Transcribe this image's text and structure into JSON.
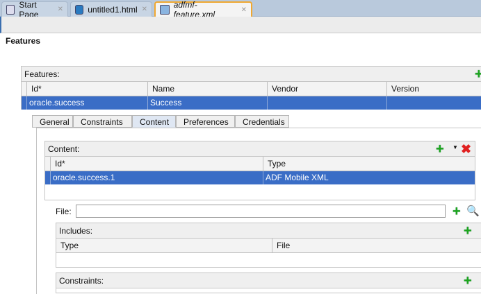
{
  "tabs": [
    {
      "label": "Start Page",
      "icon": "page-icon"
    },
    {
      "label": "untitled1.html",
      "icon": "globe-icon"
    },
    {
      "label": "adfmf-feature.xml",
      "icon": "feature-xml-icon",
      "active": true
    }
  ],
  "page_title": "Features",
  "features": {
    "label": "Features:",
    "columns": [
      "Id*",
      "Name",
      "Vendor",
      "Version"
    ],
    "rows": [
      [
        "oracle.success",
        "Success",
        "",
        ""
      ]
    ]
  },
  "subtabs": [
    "General",
    "Constraints",
    "Content",
    "Preferences",
    "Credentials"
  ],
  "active_subtab": "Content",
  "content": {
    "label": "Content:",
    "columns": [
      "Id*",
      "Type"
    ],
    "rows": [
      [
        "oracle.success.1",
        "ADF Mobile XML"
      ]
    ]
  },
  "file": {
    "label": "File:",
    "value": ""
  },
  "includes": {
    "label": "Includes:",
    "columns": [
      "Type",
      "File"
    ]
  },
  "constraints": {
    "label": "Constraints:"
  },
  "colors": {
    "selection": "#3a6dc6",
    "active_tab_border": "#f0a830"
  }
}
